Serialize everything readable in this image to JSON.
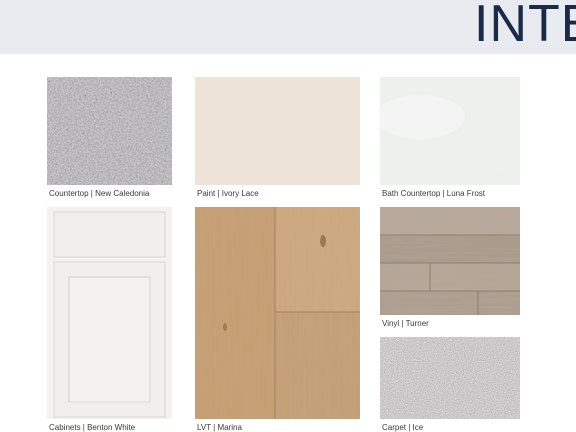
{
  "header": {
    "title": "INTE"
  },
  "swatches": [
    {
      "label": "Countertop | New Caledonia"
    },
    {
      "label": "Paint | Ivory Lace"
    },
    {
      "label": "Bath Countertop | Luna Frost"
    },
    {
      "label": "Cabinets | Benton White"
    },
    {
      "label": "LVT | Marina"
    },
    {
      "label": "Vinyl | Turner"
    },
    {
      "label": "Carpet | Ice"
    }
  ],
  "colors": {
    "header_band": "#e8ebef",
    "title_color": "#1c2a4a",
    "granite_base": "#7d7c7e",
    "paint_ivory_lace": "#ede3d7",
    "luna_frost": "#eef0ee",
    "cabinet_white": "#f2f0ec",
    "lvt_wood": "#c9a47a",
    "vinyl_wood": "#b3a394",
    "carpet_gray": "#a9a6a3"
  }
}
